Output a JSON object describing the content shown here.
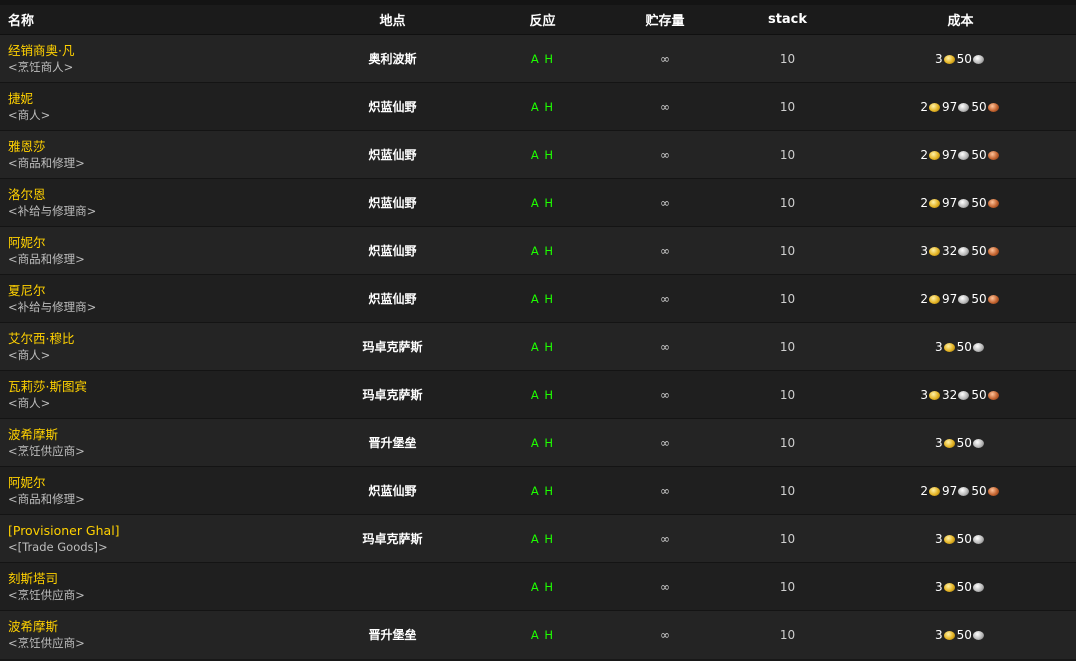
{
  "columns": {
    "name": "名称",
    "location": "地点",
    "reaction": "反应",
    "stock": "贮存量",
    "stack": "stack",
    "cost": "成本"
  },
  "coin_icons": {
    "gold": "gold-coin-icon",
    "silver": "silver-coin-icon",
    "copper": "copper-coin-icon"
  },
  "colors": {
    "name": "#ffd100",
    "reaction": "#1eff00",
    "gold": "#e3b222",
    "silver": "#b9b9b9",
    "copper": "#c2622e"
  },
  "rows": [
    {
      "name": "经销商奥·凡",
      "title": "<烹饪商人>",
      "location": "奥利波斯",
      "reaction": "A H",
      "stock": "∞",
      "stack": "10",
      "cost": {
        "gold": "3",
        "silver": "50",
        "copper": ""
      }
    },
    {
      "name": "捷妮",
      "title": "<商人>",
      "location": "炽蓝仙野",
      "reaction": "A H",
      "stock": "∞",
      "stack": "10",
      "cost": {
        "gold": "2",
        "silver": "97",
        "copper": "50"
      }
    },
    {
      "name": "雅恩莎",
      "title": "<商品和修理>",
      "location": "炽蓝仙野",
      "reaction": "A H",
      "stock": "∞",
      "stack": "10",
      "cost": {
        "gold": "2",
        "silver": "97",
        "copper": "50"
      }
    },
    {
      "name": "洛尔恩",
      "title": "<补给与修理商>",
      "location": "炽蓝仙野",
      "reaction": "A H",
      "stock": "∞",
      "stack": "10",
      "cost": {
        "gold": "2",
        "silver": "97",
        "copper": "50"
      }
    },
    {
      "name": "阿妮尔",
      "title": "<商品和修理>",
      "location": "炽蓝仙野",
      "reaction": "A H",
      "stock": "∞",
      "stack": "10",
      "cost": {
        "gold": "3",
        "silver": "32",
        "copper": "50"
      }
    },
    {
      "name": "夏尼尔",
      "title": "<补给与修理商>",
      "location": "炽蓝仙野",
      "reaction": "A H",
      "stock": "∞",
      "stack": "10",
      "cost": {
        "gold": "2",
        "silver": "97",
        "copper": "50"
      }
    },
    {
      "name": "艾尔西·穆比",
      "title": "<商人>",
      "location": "玛卓克萨斯",
      "reaction": "A H",
      "stock": "∞",
      "stack": "10",
      "cost": {
        "gold": "3",
        "silver": "50",
        "copper": ""
      }
    },
    {
      "name": "瓦莉莎·斯图宾",
      "title": "<商人>",
      "location": "玛卓克萨斯",
      "reaction": "A H",
      "stock": "∞",
      "stack": "10",
      "cost": {
        "gold": "3",
        "silver": "32",
        "copper": "50"
      }
    },
    {
      "name": "波希摩斯",
      "title": "<烹饪供应商>",
      "location": "晋升堡垒",
      "reaction": "A H",
      "stock": "∞",
      "stack": "10",
      "cost": {
        "gold": "3",
        "silver": "50",
        "copper": ""
      }
    },
    {
      "name": "阿妮尔",
      "title": "<商品和修理>",
      "location": "炽蓝仙野",
      "reaction": "A H",
      "stock": "∞",
      "stack": "10",
      "cost": {
        "gold": "2",
        "silver": "97",
        "copper": "50"
      }
    },
    {
      "name": "[Provisioner Ghal]",
      "title": "<[Trade Goods]>",
      "location": "玛卓克萨斯",
      "reaction": "A H",
      "stock": "∞",
      "stack": "10",
      "cost": {
        "gold": "3",
        "silver": "50",
        "copper": ""
      }
    },
    {
      "name": "刻斯塔司",
      "title": "<烹饪供应商>",
      "location": "",
      "reaction": "A H",
      "stock": "∞",
      "stack": "10",
      "cost": {
        "gold": "3",
        "silver": "50",
        "copper": ""
      }
    },
    {
      "name": "波希摩斯",
      "title": "<烹饪供应商>",
      "location": "晋升堡垒",
      "reaction": "A H",
      "stock": "∞",
      "stack": "10",
      "cost": {
        "gold": "3",
        "silver": "50",
        "copper": ""
      }
    }
  ]
}
